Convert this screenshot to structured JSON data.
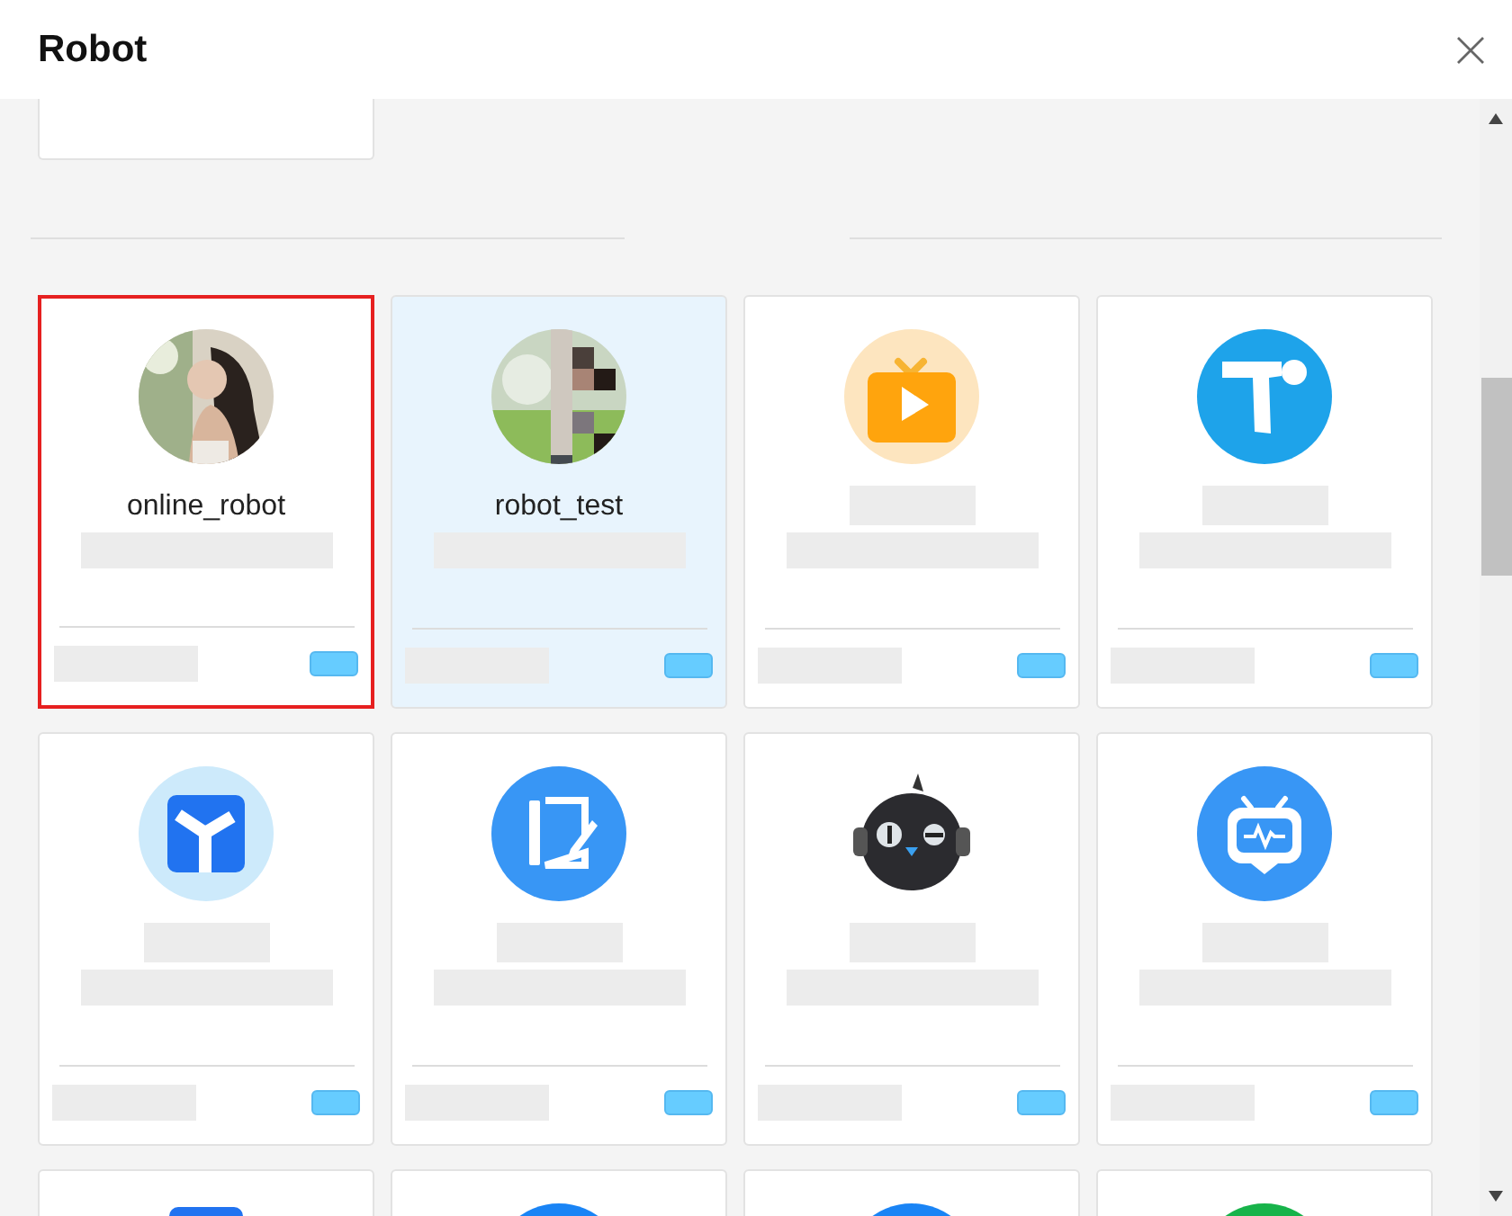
{
  "dialog": {
    "title": "Robot"
  },
  "robots": [
    {
      "name": "online_robot",
      "selected": true,
      "highlighted": false
    },
    {
      "name": "robot_test",
      "kind": "pixelated",
      "selected": false,
      "highlighted": true
    },
    {
      "kind": "tv",
      "selected": false,
      "highlighted": false
    },
    {
      "kind": "t",
      "selected": false,
      "highlighted": false
    },
    {
      "kind": "y",
      "selected": false,
      "highlighted": false
    },
    {
      "kind": "notebook",
      "selected": false,
      "highlighted": false
    },
    {
      "kind": "bird",
      "selected": false,
      "highlighted": false
    },
    {
      "kind": "robot",
      "selected": false,
      "highlighted": false
    },
    {
      "kind": "square",
      "selected": false,
      "highlighted": false
    },
    {
      "kind": "blue",
      "selected": false,
      "highlighted": false
    },
    {
      "kind": "blue",
      "selected": false,
      "highlighted": false
    },
    {
      "kind": "green",
      "selected": false,
      "highlighted": false
    }
  ]
}
